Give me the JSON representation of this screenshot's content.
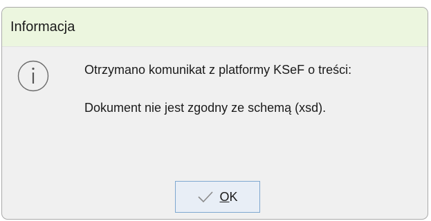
{
  "dialog": {
    "title": "Informacja",
    "message_line1": "Otrzymano komunikat z platformy KSeF o treści:",
    "message_line2": "Dokument nie jest zgodny ze schemą (xsd).",
    "icon": "info-icon",
    "ok_button": {
      "mnemonic": "O",
      "rest": "K",
      "icon": "checkmark-icon"
    }
  },
  "colors": {
    "titlebar_bg": "#ecf6df",
    "body_bg": "#f0f0f0",
    "button_border": "#7ea7cf",
    "button_bg": "#e8eef6"
  }
}
